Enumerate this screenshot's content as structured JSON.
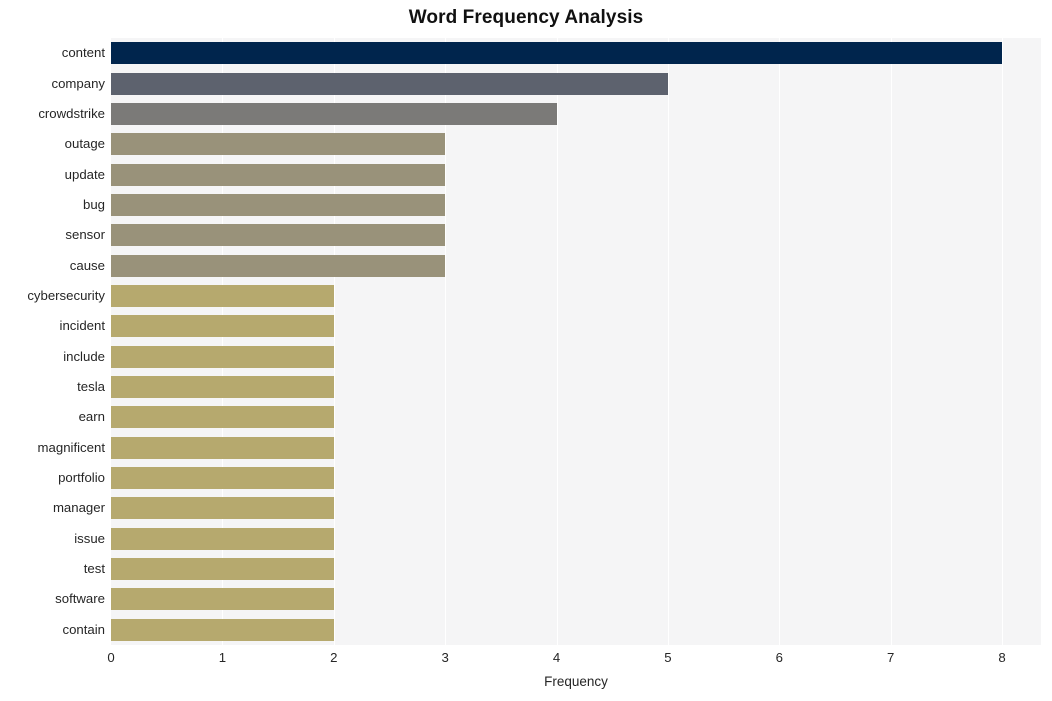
{
  "chart_data": {
    "type": "bar",
    "orientation": "horizontal",
    "title": "Word Frequency Analysis",
    "xlabel": "Frequency",
    "ylabel": "",
    "xlim": [
      0,
      8.35
    ],
    "ylim": [
      0,
      20
    ],
    "grid": true,
    "grid_axis": "x",
    "legend": false,
    "plot_background": "#f5f5f6",
    "figure_background": "#ffffff",
    "gridline_color": "#ffffff",
    "xticks": [
      0,
      1,
      2,
      3,
      4,
      5,
      6,
      7,
      8
    ],
    "xtick_labels": [
      "0",
      "1",
      "2",
      "3",
      "4",
      "5",
      "6",
      "7",
      "8"
    ],
    "categories": [
      "content",
      "company",
      "crowdstrike",
      "outage",
      "update",
      "bug",
      "sensor",
      "cause",
      "cybersecurity",
      "incident",
      "include",
      "tesla",
      "earn",
      "magnificent",
      "portfolio",
      "manager",
      "issue",
      "test",
      "software",
      "contain"
    ],
    "values": [
      8,
      5,
      4,
      3,
      3,
      3,
      3,
      3,
      2,
      2,
      2,
      2,
      2,
      2,
      2,
      2,
      2,
      2,
      2,
      2
    ],
    "bar_colors": [
      "#00254d",
      "#5d626e",
      "#7b7a78",
      "#99927a",
      "#99927a",
      "#99927a",
      "#99927a",
      "#99927a",
      "#b6a96e",
      "#b6a96e",
      "#b6a96e",
      "#b6a96e",
      "#b6a96e",
      "#b6a96e",
      "#b6a96e",
      "#b6a96e",
      "#b6a96e",
      "#b6a96e",
      "#b6a96e",
      "#b6a96e"
    ]
  }
}
